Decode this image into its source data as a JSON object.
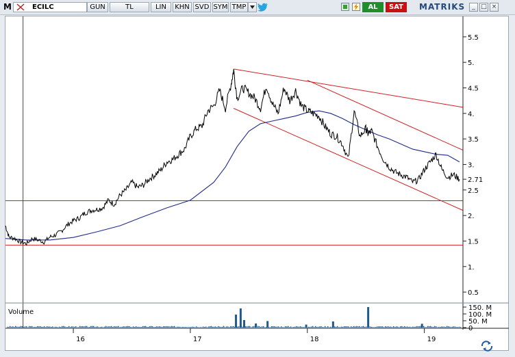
{
  "toolbar": {
    "logo": "M",
    "symbol": "ECILC",
    "buttons": [
      "GUN",
      "TL",
      "LIN",
      "KHN",
      "SVD",
      "SYM",
      "TMP"
    ],
    "buy_label": "AL",
    "sell_label": "SAT",
    "brand": "MATRIKS",
    "window_buttons": [
      "_",
      "□",
      "×"
    ]
  },
  "chart_data": {
    "type": "line",
    "symbol": "ECILC",
    "ylim": [
      0.3,
      5.9
    ],
    "y_ticks": [
      0.5,
      1,
      1.5,
      2,
      2.5,
      3,
      3.5,
      4,
      4.5,
      5,
      5.5
    ],
    "y_tick_labels": [
      "0.5",
      "1.",
      "1.5",
      "2.",
      "2.5",
      "3.",
      "3.5",
      "4.",
      "4.5",
      "5.",
      "5.5"
    ],
    "x_tick_labels": [
      "16",
      "17",
      "18",
      "19"
    ],
    "xlim": [
      15.42,
      19.33
    ],
    "last_price_label": "2.71",
    "last_price": 2.71,
    "price_series": {
      "x": [
        15.42,
        15.45,
        15.5,
        15.55,
        15.6,
        15.65,
        15.7,
        15.75,
        15.8,
        15.85,
        15.9,
        15.95,
        16.0,
        16.05,
        16.1,
        16.15,
        16.2,
        16.25,
        16.3,
        16.35,
        16.4,
        16.45,
        16.5,
        16.55,
        16.6,
        16.65,
        16.7,
        16.75,
        16.8,
        16.85,
        16.9,
        16.95,
        17.0,
        17.05,
        17.1,
        17.15,
        17.2,
        17.25,
        17.3,
        17.35,
        17.37,
        17.4,
        17.45,
        17.5,
        17.55,
        17.6,
        17.65,
        17.7,
        17.75,
        17.8,
        17.85,
        17.9,
        17.95,
        18.0,
        18.05,
        18.1,
        18.15,
        18.2,
        18.25,
        18.3,
        18.35,
        18.4,
        18.45,
        18.5,
        18.52,
        18.55,
        18.6,
        18.65,
        18.7,
        18.75,
        18.8,
        18.85,
        18.9,
        18.95,
        19.0,
        19.05,
        19.1,
        19.15,
        19.2,
        19.25,
        19.3
      ],
      "y": [
        1.8,
        1.58,
        1.55,
        1.48,
        1.45,
        1.55,
        1.52,
        1.48,
        1.58,
        1.62,
        1.7,
        1.82,
        1.9,
        1.95,
        2.05,
        2.1,
        2.12,
        2.15,
        2.3,
        2.22,
        2.4,
        2.5,
        2.65,
        2.55,
        2.6,
        2.72,
        2.8,
        2.9,
        3.05,
        3.1,
        3.2,
        3.3,
        3.55,
        3.7,
        3.75,
        4.05,
        4.15,
        4.45,
        4.1,
        4.6,
        4.85,
        4.3,
        4.5,
        4.4,
        4.3,
        4.1,
        4.55,
        4.2,
        4.0,
        4.5,
        4.25,
        4.45,
        4.15,
        4.05,
        4.0,
        3.95,
        3.75,
        3.6,
        3.55,
        3.4,
        3.1,
        4.05,
        3.55,
        3.7,
        3.6,
        3.65,
        3.35,
        3.1,
        2.95,
        2.85,
        2.8,
        2.75,
        2.65,
        2.7,
        2.9,
        3.05,
        3.2,
        2.9,
        2.75,
        2.8,
        2.71
      ]
    },
    "moving_average": {
      "x": [
        15.42,
        15.6,
        15.8,
        16.0,
        16.2,
        16.4,
        16.6,
        16.8,
        17.0,
        17.2,
        17.3,
        17.4,
        17.5,
        17.6,
        17.7,
        17.8,
        17.9,
        18.0,
        18.1,
        18.2,
        18.3,
        18.4,
        18.5,
        18.6,
        18.7,
        18.8,
        18.9,
        19.0,
        19.1,
        19.2,
        19.3
      ],
      "y": [
        1.55,
        1.52,
        1.52,
        1.57,
        1.68,
        1.8,
        1.98,
        2.15,
        2.3,
        2.65,
        2.95,
        3.35,
        3.65,
        3.8,
        3.85,
        3.9,
        3.95,
        4.02,
        4.05,
        4.0,
        3.9,
        3.78,
        3.68,
        3.58,
        3.5,
        3.4,
        3.3,
        3.25,
        3.2,
        3.18,
        3.05
      ]
    },
    "horizontal_lines": [
      2.29,
      1.42
    ],
    "trend_lines": [
      {
        "x": [
          17.37,
          19.33
        ],
        "y": [
          4.87,
          4.12
        ]
      },
      {
        "x": [
          17.37,
          19.33
        ],
        "y": [
          4.1,
          2.1
        ]
      },
      {
        "x": [
          18.0,
          19.33
        ],
        "y": [
          4.65,
          3.28
        ]
      }
    ],
    "cursor_x": 15.57,
    "volume": {
      "label": "Volume",
      "tick_labels": [
        "150. M",
        "100. M",
        "50. M",
        "0"
      ],
      "ticks": [
        150,
        100,
        50,
        0
      ],
      "ylim": [
        0,
        160
      ],
      "spikes": [
        {
          "x": 17.39,
          "v": 95
        },
        {
          "x": 17.43,
          "v": 140
        },
        {
          "x": 17.46,
          "v": 55
        },
        {
          "x": 17.56,
          "v": 30
        },
        {
          "x": 17.66,
          "v": 48
        },
        {
          "x": 17.99,
          "v": 22
        },
        {
          "x": 18.22,
          "v": 45
        },
        {
          "x": 18.52,
          "v": 150
        },
        {
          "x": 18.98,
          "v": 28
        }
      ],
      "baseline": 10
    }
  }
}
